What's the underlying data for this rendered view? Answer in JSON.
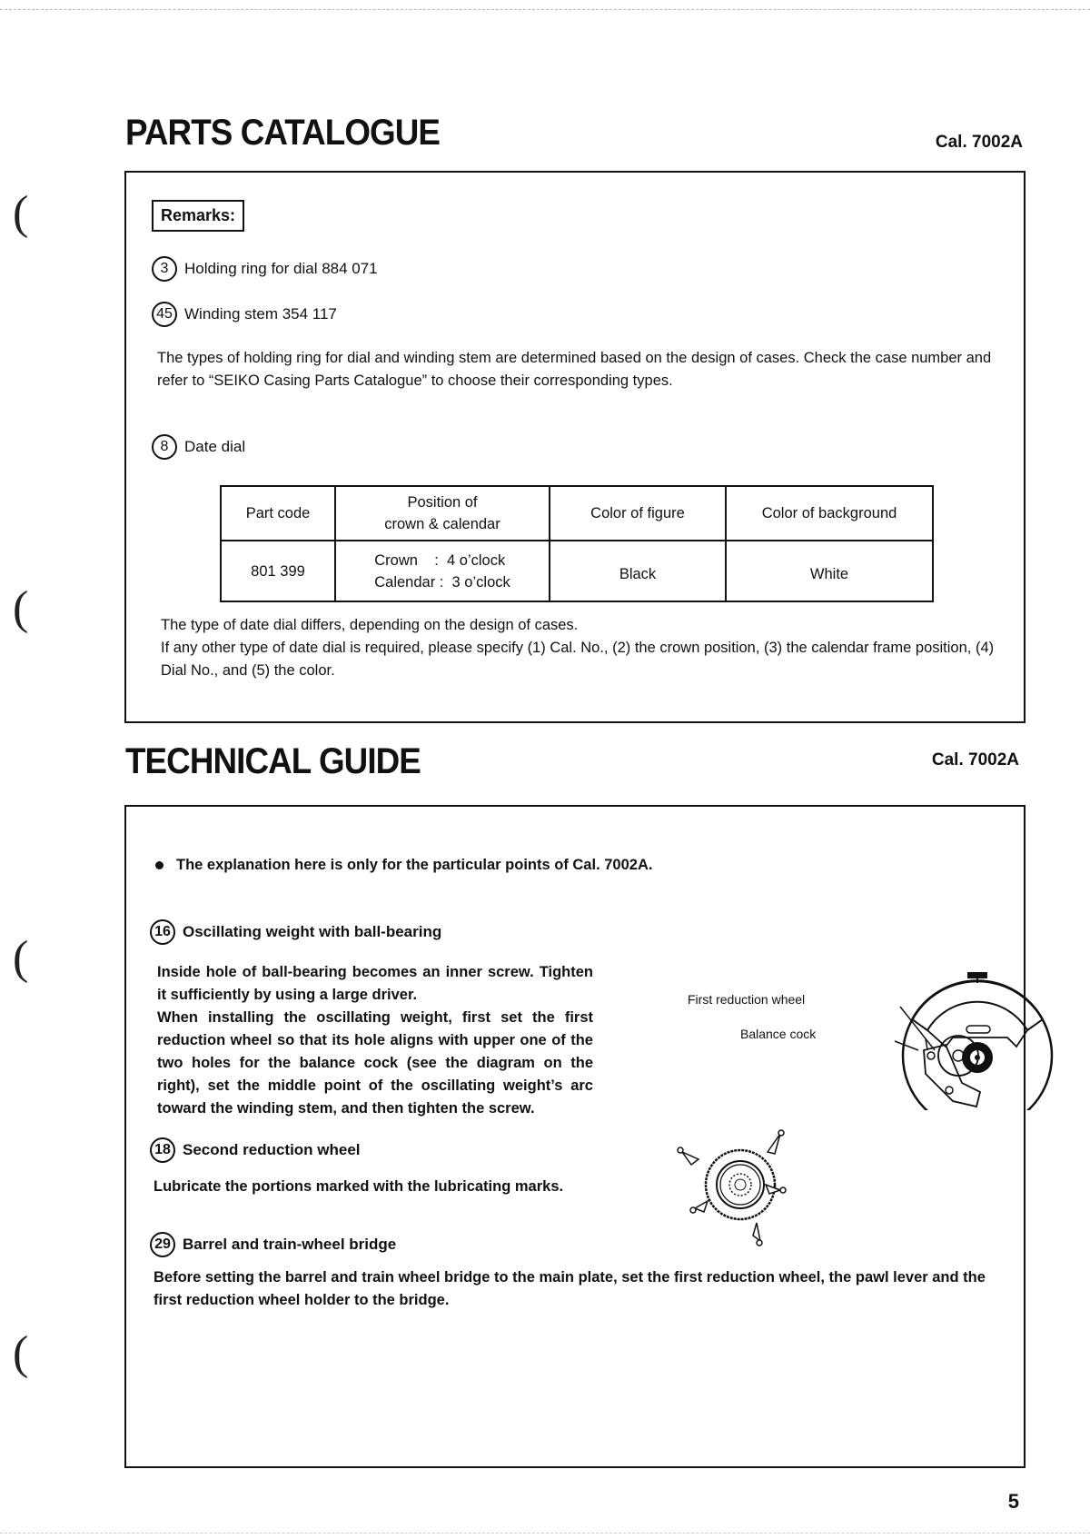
{
  "parts_catalogue": {
    "title": "PARTS CATALOGUE",
    "caliber": "Cal. 7002A",
    "remarks_label": "Remarks:",
    "items": [
      {
        "number": "3",
        "label": "Holding ring for dial  884 071"
      },
      {
        "number": "45",
        "label": "Winding stem  354 117"
      }
    ],
    "note_1": "The types of holding ring for dial and winding stem are determined based on the design of cases.  Check the case number and refer to “SEIKO Casing Parts Catalogue” to choose their corresponding types.",
    "date_dial": {
      "number": "8",
      "label": "Date dial"
    },
    "table": {
      "headers": [
        "Part code",
        "Position of crown & calendar",
        "Color of figure",
        "Color of background"
      ],
      "header_line1": "Position of",
      "header_line2": "crown & calendar",
      "rows": [
        {
          "part_code": "801 399",
          "crown": "Crown    :  4 o’clock",
          "calendar": "Calendar :  3 o’clock",
          "figure_color": "Black",
          "background_color": "White"
        }
      ]
    },
    "note_2_line1": "The type of date dial differs, depending on the design of cases.",
    "note_2_line2": "If any other type of date dial is required, please specify (1) Cal. No., (2) the crown position, (3) the calendar frame position, (4) Dial No., and (5) the color."
  },
  "technical_guide": {
    "title": "TECHNICAL GUIDE",
    "caliber": "Cal. 7002A",
    "bullet": "The explanation here is only for the particular points of Cal. 7002A.",
    "sections": [
      {
        "number": "16",
        "heading": "Oscillating weight with ball-bearing",
        "text": "Inside hole of ball-bearing becomes an inner screw.  Tighten it sufficiently by using a large driver.",
        "text2": "When installing the oscillating weight, first set the first reduction wheel so that its hole aligns with upper one of the two holes for the balance cock (see the diagram on the right), set the middle point of the oscillating weight’s arc toward the winding stem, and then tighten the screw."
      },
      {
        "number": "18",
        "heading": "Second reduction wheel",
        "text": "Lubricate the portions marked with the lubricating marks."
      },
      {
        "number": "29",
        "heading": "Barrel and train-wheel bridge",
        "text": "Before setting the barrel and train wheel bridge to the main plate, set the first reduction wheel, the pawl lever and the first reduction wheel holder to the bridge."
      }
    ],
    "diagram_labels": {
      "first_reduction_wheel": "First reduction wheel",
      "balance_cock": "Balance cock"
    }
  },
  "page_number": "5"
}
